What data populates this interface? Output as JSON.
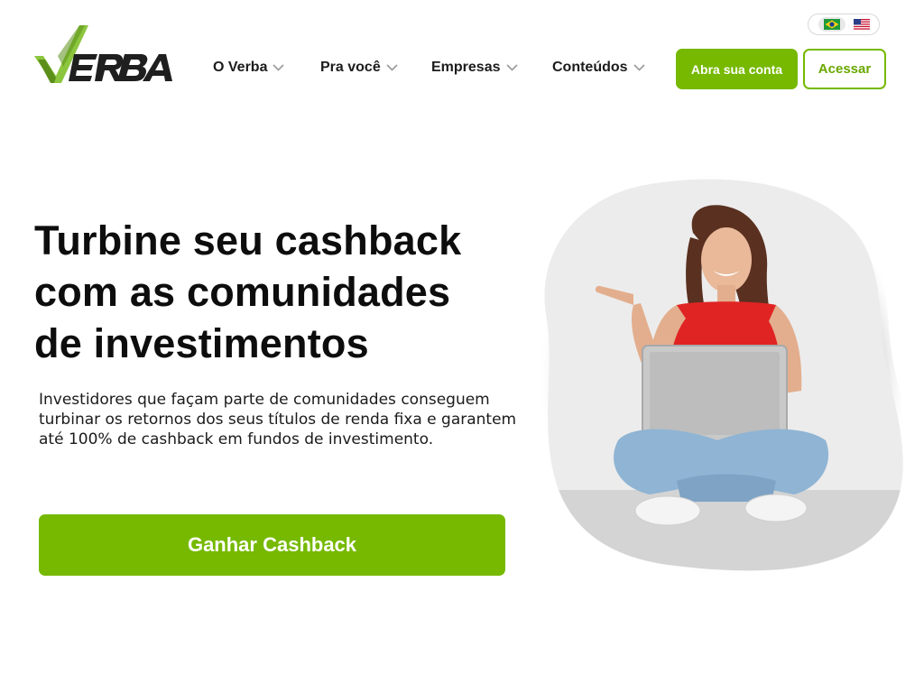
{
  "brand": {
    "logo_text": "VERBA",
    "logo_alt": "Verba",
    "colors": {
      "primary_green": "#76b900",
      "text_dark": "#111111"
    }
  },
  "language_switch": {
    "options": [
      {
        "code": "pt-BR",
        "icon": "brazil-flag-icon"
      },
      {
        "code": "en-US",
        "icon": "usa-flag-icon"
      }
    ]
  },
  "nav": {
    "items": [
      {
        "label": "O Verba",
        "icon": "chevron-down-icon"
      },
      {
        "label": "Pra você",
        "icon": "chevron-down-icon"
      },
      {
        "label": "Empresas",
        "icon": "chevron-down-icon"
      },
      {
        "label": "Conteúdos",
        "icon": "chevron-down-icon"
      }
    ]
  },
  "header_actions": {
    "open_account": "Abra sua conta",
    "login": "Acessar"
  },
  "hero": {
    "title_line1": "Turbine seu cashback",
    "title_line2": "com as comunidades",
    "title_line3": "de investimentos",
    "description_line1": "Investidores que façam parte de comunidades conseguem",
    "description_line2": "turbinar os retornos dos seus títulos de renda fixa e garantem",
    "description_line3": "até 100% de cashback em fundos de investimento.",
    "cta": "Ganhar Cashback",
    "image_alt": "Mulher sorridente sentada no chão com notebook apontando para o lado"
  }
}
